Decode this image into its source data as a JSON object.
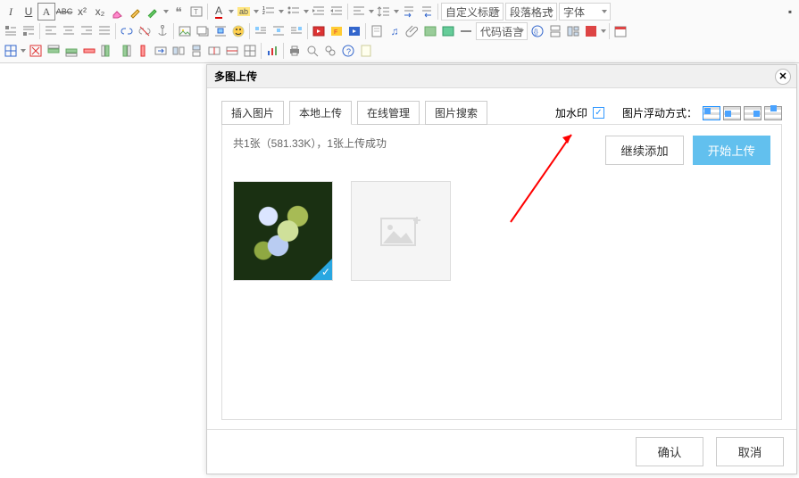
{
  "toolbar": {
    "combos": {
      "title_style": "自定义标题",
      "para_format": "段落格式",
      "font": "字体",
      "code_lang": "代码语言"
    }
  },
  "dialog": {
    "title": "多图上传",
    "tabs": {
      "insert": "插入图片",
      "local": "本地上传",
      "online": "在线管理",
      "search": "图片搜索"
    },
    "watermark_label": "加水印",
    "float_label": "图片浮动方式：",
    "status": "共1张（581.33K），1张上传成功",
    "continue": "继续添加",
    "start": "开始上传",
    "ok": "确认",
    "cancel": "取消"
  }
}
